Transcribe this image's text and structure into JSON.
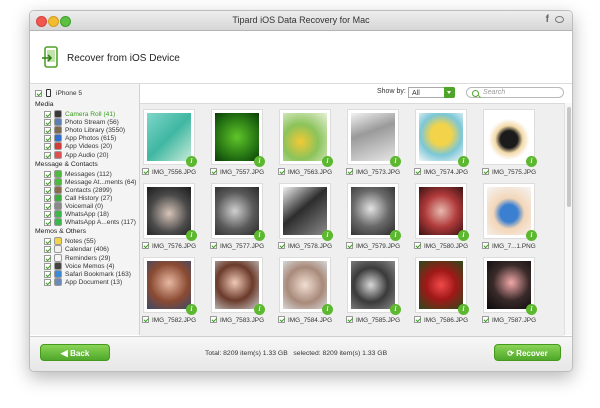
{
  "window": {
    "title": "Tipard iOS Data Recovery for Mac",
    "facebook_glyph": "f"
  },
  "header": {
    "title": "Recover from iOS Device"
  },
  "sidebar": {
    "device": "iPhone 5",
    "sections": [
      {
        "name": "Media",
        "items": [
          {
            "label": "Camera Roll (41)",
            "icon": "camera-roll-icon",
            "color": "#3a3a3a",
            "active": true
          },
          {
            "label": "Photo Stream (56)",
            "icon": "photo-stream-icon",
            "color": "#5a7fb0"
          },
          {
            "label": "Photo Library (3550)",
            "icon": "photo-library-icon",
            "color": "#7a6a50"
          },
          {
            "label": "App Photos (615)",
            "icon": "app-photos-icon",
            "color": "#2e6fd1"
          },
          {
            "label": "App Videos (20)",
            "icon": "app-videos-icon",
            "color": "#d43a3a"
          },
          {
            "label": "App Audio (20)",
            "icon": "app-audio-icon",
            "color": "#e05050"
          }
        ]
      },
      {
        "name": "Message & Contacts",
        "items": [
          {
            "label": "Messages (112)",
            "icon": "messages-icon",
            "color": "#4cba3c"
          },
          {
            "label": "Message At...ments (64)",
            "icon": "message-attachments-icon",
            "color": "#4cba3c"
          },
          {
            "label": "Contacts (2899)",
            "icon": "contacts-icon",
            "color": "#8a6a4a"
          },
          {
            "label": "Call History (27)",
            "icon": "call-history-icon",
            "color": "#3cae3c"
          },
          {
            "label": "Voicemail (0)",
            "icon": "voicemail-icon",
            "color": "#8a8a8a"
          },
          {
            "label": "WhatsApp (18)",
            "icon": "whatsapp-icon",
            "color": "#3cb84a"
          },
          {
            "label": "WhatsApp A...ents (117)",
            "icon": "whatsapp-attachments-icon",
            "color": "#3cb84a"
          }
        ]
      },
      {
        "name": "Memos & Others",
        "items": [
          {
            "label": "Notes (55)",
            "icon": "notes-icon",
            "color": "#f2d34a"
          },
          {
            "label": "Calendar (406)",
            "icon": "calendar-icon",
            "color": "#f1f1f1"
          },
          {
            "label": "Reminders (29)",
            "icon": "reminders-icon",
            "color": "#f5f5f5"
          },
          {
            "label": "Voice Memos (4)",
            "icon": "voice-memos-icon",
            "color": "#444444"
          },
          {
            "label": "Safari Bookmark (163)",
            "icon": "safari-icon",
            "color": "#3a8ad8"
          },
          {
            "label": "App Document (13)",
            "icon": "app-document-icon",
            "color": "#6a8ab8"
          }
        ]
      }
    ]
  },
  "toolbar": {
    "show_by_label": "Show by:",
    "show_by_value": "All",
    "search_placeholder": "Search"
  },
  "grid": {
    "rows": [
      [
        {
          "name": "IMG_7556.JPG",
          "bg": "linear-gradient(135deg,#7fd6c9,#3fb7a2 50%,#c8ecd8)"
        },
        {
          "name": "IMG_7557.JPG",
          "bg": "radial-gradient(circle at 50% 50%,#5fc52a,#1f6a10 70%,#0d3a08)"
        },
        {
          "name": "IMG_7563.JPG",
          "bg": "radial-gradient(circle at 40% 60%,#f3c935,#8bc35a 45%,#e8f1d8)"
        },
        {
          "name": "IMG_7573.JPG",
          "bg": "linear-gradient(160deg,#f2f2f2,#9a9a9a 40%,#e6e6e6)"
        },
        {
          "name": "IMG_7574.JPG",
          "bg": "radial-gradient(circle at 50% 45%,#f2d34a 30%,#7bc7d8 60%,#f6f6f6)"
        },
        {
          "name": "IMG_7575.JPG",
          "bg": "radial-gradient(circle at 50% 55%,#1b1b1b 25%,#f2d9a8 40%,#ffffff 60%)"
        }
      ],
      [
        {
          "name": "IMG_7576.JPG",
          "bg": "radial-gradient(circle at 50% 55%,#d7c4b8,#4a4a4a 55%,#1a1a1a)"
        },
        {
          "name": "IMG_7577.JPG",
          "bg": "radial-gradient(circle at 45% 50%,#cfcfcf,#5a5a5a 55%,#2a2a2a)"
        },
        {
          "name": "IMG_7578.JPG",
          "bg": "linear-gradient(140deg,#f0f0f0,#2d2d2d 45%,#8a8a8a)"
        },
        {
          "name": "IMG_7579.JPG",
          "bg": "radial-gradient(circle at 45% 45%,#e3e3e3,#6a6a6a 50%,#2a2a2a)"
        },
        {
          "name": "IMG_7580.JPG",
          "bg": "radial-gradient(circle at 50% 50%,#e8b9b0,#b03a3a 50%,#3a1212)"
        },
        {
          "name": "IMG_7...1.PNG",
          "bg": "radial-gradient(circle at 50% 55%,#3a7fd0 25%,#f3d6b8 45%,#f5f5f5)"
        }
      ],
      [
        {
          "name": "IMG_7582.JPG",
          "bg": "radial-gradient(circle at 50% 45%,#e8b8a2,#8a4a32 55%,#3a4a6a)"
        },
        {
          "name": "IMG_7583.JPG",
          "bg": "radial-gradient(circle at 45% 45%,#f0c8b6,#6a3a2a 50%,#c8c8c8)"
        },
        {
          "name": "IMG_7584.JPG",
          "bg": "radial-gradient(circle at 50% 50%,#f2ded2,#a88a7a 55%,#d8d8d8)"
        },
        {
          "name": "IMG_7585.JPG",
          "bg": "radial-gradient(circle at 45% 50%,#d8d8d8,#3a3a3a 50%,#8a8a8a)"
        },
        {
          "name": "IMG_7586.JPG",
          "bg": "radial-gradient(circle at 50% 50%,#f04a4a,#a01818 45%,#2a4a1a)"
        },
        {
          "name": "IMG_7587.JPG",
          "bg": "radial-gradient(circle at 55% 45%,#f2a8a8,#3a2a2a 50%,#0a0a0a)"
        }
      ]
    ]
  },
  "footer": {
    "back_label": "Back",
    "total_text": "Total: 8209 item(s) 1.33 GB",
    "selected_text": "selected: 8209 item(s) 1.33 GB",
    "recover_label": "Recover"
  },
  "colors": {
    "accent": "#5cb82f",
    "active_item": "#3a9e1e"
  }
}
